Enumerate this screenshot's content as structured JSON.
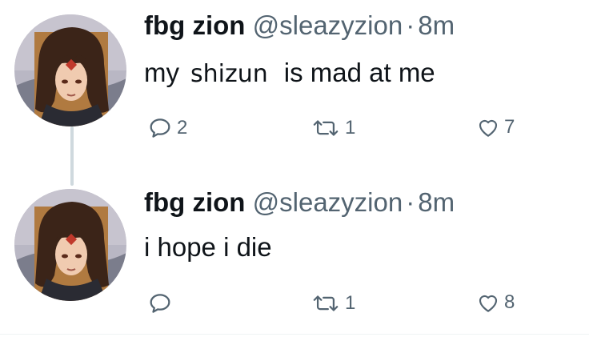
{
  "tweets": [
    {
      "display_name": "fbg zion",
      "handle": "@sleazyzion",
      "separator": "·",
      "time": "8m",
      "text_before": "my",
      "text_pasted": "shizun",
      "text_after": "is mad at me",
      "replies": "2",
      "retweets": "1",
      "likes": "7",
      "avatar_icon": "anime-character-avatar"
    },
    {
      "display_name": "fbg zion",
      "handle": "@sleazyzion",
      "separator": "·",
      "time": "8m",
      "text": "i hope i die",
      "replies": "",
      "retweets": "1",
      "likes": "8",
      "avatar_icon": "anime-character-avatar"
    }
  ],
  "icons": {
    "reply": "reply-icon",
    "retweet": "retweet-icon",
    "like": "like-icon"
  },
  "colors": {
    "text": "#0f1419",
    "secondary": "#536471",
    "thread_line": "#cfd9de"
  }
}
